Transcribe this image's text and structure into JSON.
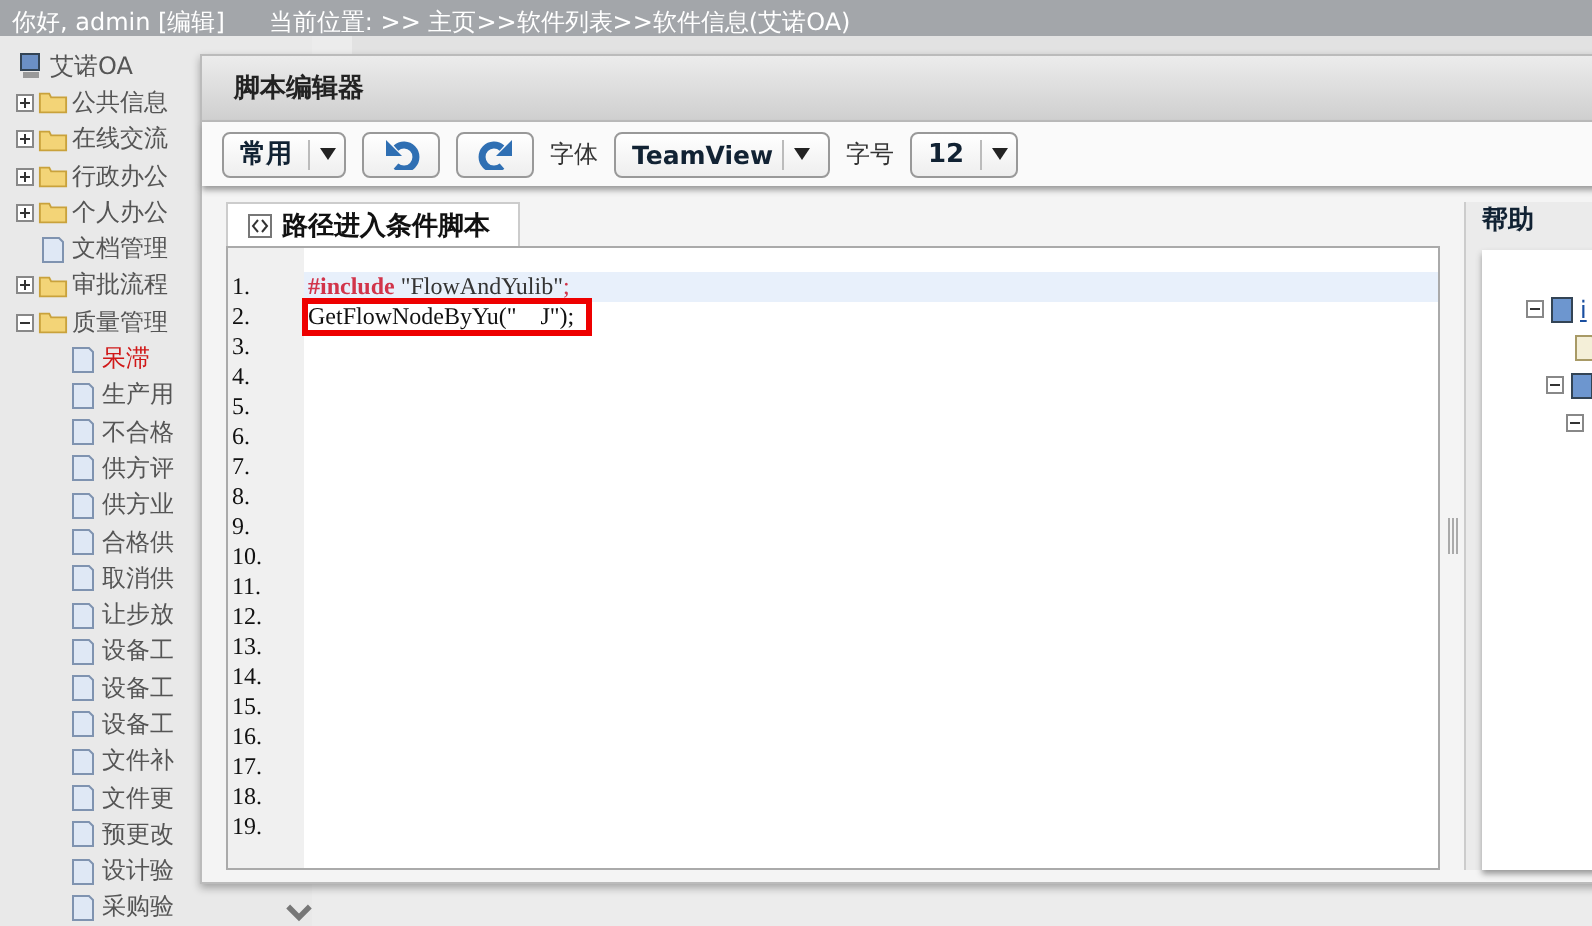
{
  "header": {
    "greeting": "你好, admin [编辑]",
    "location": "当前位置: >> 主页>>软件列表>>软件信息(艾诺OA)"
  },
  "sidebar": {
    "root": "艾诺OA",
    "items": [
      {
        "label": "公共信息",
        "kind": "folder",
        "expanded": false,
        "selected": false
      },
      {
        "label": "在线交流",
        "kind": "folder",
        "expanded": false,
        "selected": false
      },
      {
        "label": "行政办公",
        "kind": "folder",
        "expanded": false,
        "selected": false
      },
      {
        "label": "个人办公",
        "kind": "folder",
        "expanded": false,
        "selected": false
      },
      {
        "label": "文档管理",
        "kind": "doc",
        "selected": false
      },
      {
        "label": "审批流程",
        "kind": "folder",
        "expanded": false,
        "selected": false
      },
      {
        "label": "质量管理",
        "kind": "folder",
        "expanded": true,
        "selected": false,
        "children": [
          {
            "label": "呆滞",
            "selected": true
          },
          {
            "label": "生产用",
            "selected": false
          },
          {
            "label": "不合格",
            "selected": false
          },
          {
            "label": "供方评",
            "selected": false
          },
          {
            "label": "供方业",
            "selected": false
          },
          {
            "label": "合格供",
            "selected": false
          },
          {
            "label": "取消供",
            "selected": false
          },
          {
            "label": "让步放",
            "selected": false
          },
          {
            "label": "设备工",
            "selected": false
          },
          {
            "label": "设备工",
            "selected": false
          },
          {
            "label": "设备工",
            "selected": false
          },
          {
            "label": "文件补",
            "selected": false
          },
          {
            "label": "文件更",
            "selected": false
          },
          {
            "label": "预更改",
            "selected": false
          },
          {
            "label": "设计验",
            "selected": false
          },
          {
            "label": "采购验",
            "selected": false
          }
        ]
      }
    ]
  },
  "dialog": {
    "title": "脚本编辑器",
    "toolbar": {
      "style_select": "常用",
      "font_label": "字体",
      "font_select": "TeamView",
      "size_label": "字号",
      "size_select": "12"
    },
    "tab": {
      "label": "路径进入条件脚本",
      "selected": true
    },
    "line_numbers": [
      "1.",
      "2.",
      "3.",
      "4.",
      "5.",
      "6.",
      "7.",
      "8.",
      "9.",
      "10.",
      "11.",
      "12.",
      "13.",
      "14.",
      "15.",
      "16.",
      "17.",
      "18.",
      "19."
    ],
    "code_lines": [
      {
        "selected": true,
        "boxed": false,
        "tokens": [
          {
            "kind": "keyword",
            "text": "#include"
          },
          {
            "kind": "string",
            "text": " \"FlowAndYulib\""
          },
          {
            "kind": "punct",
            "text": ";"
          }
        ]
      },
      {
        "selected": false,
        "boxed": true,
        "tokens": [
          {
            "kind": "plain",
            "text": "GetFlowNodeByYu(\"    J\");"
          }
        ]
      }
    ],
    "help": {
      "title": "帮助",
      "tree_link": "i"
    }
  }
}
